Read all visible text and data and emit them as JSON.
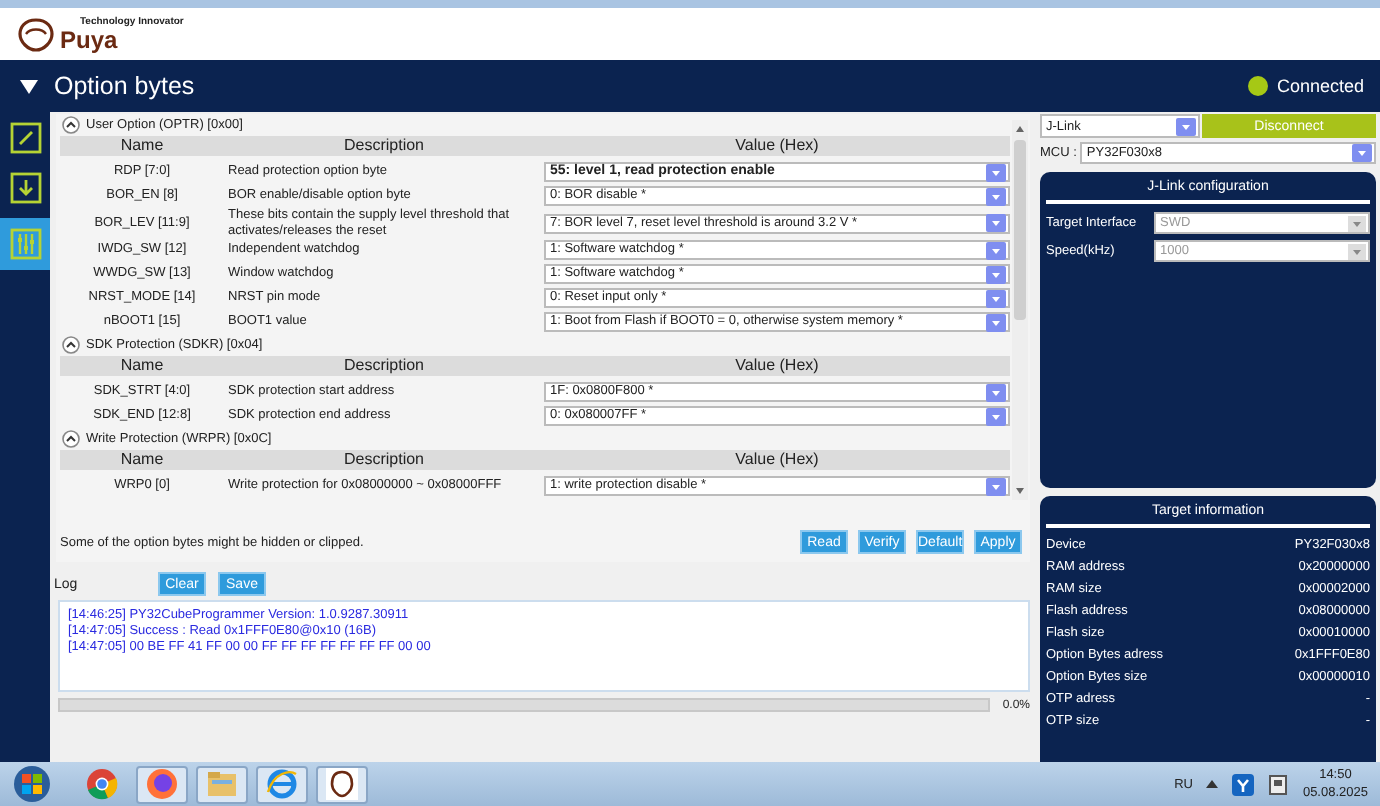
{
  "app": {
    "logo_text": "Puya",
    "tagline": "Technology Innovator"
  },
  "header": {
    "title": "Option bytes",
    "status": "Connected",
    "connected": true
  },
  "nav": [
    {
      "kind": "edit",
      "selected": false
    },
    {
      "kind": "download",
      "selected": false
    },
    {
      "kind": "sliders",
      "selected": true
    }
  ],
  "sections": [
    {
      "title": "User Option (OPTR) [0x00]",
      "expanded": true,
      "columns": [
        "Name",
        "Description",
        "Value (Hex)"
      ],
      "rows": [
        {
          "name": "RDP [7:0]",
          "description": "Read protection option byte",
          "value": "55: level 1, read protection enable",
          "emphasized": true
        },
        {
          "name": "BOR_EN [8]",
          "description": "BOR enable/disable option byte",
          "value": "0: BOR disable *",
          "emphasized": false
        },
        {
          "name": "BOR_LEV [11:9]",
          "description": "These bits contain the supply level threshold that activates/releases the reset",
          "value": "7: BOR level 7, reset level threshold is around 3.2 V *",
          "emphasized": false
        },
        {
          "name": "IWDG_SW [12]",
          "description": "Independent watchdog",
          "value": "1: Software watchdog *",
          "emphasized": false
        },
        {
          "name": "WWDG_SW [13]",
          "description": "Window watchdog",
          "value": "1: Software watchdog *",
          "emphasized": false
        },
        {
          "name": "NRST_MODE [14]",
          "description": "NRST pin mode",
          "value": "0: Reset input only *",
          "emphasized": false
        },
        {
          "name": "nBOOT1 [15]",
          "description": "BOOT1 value",
          "value": "1: Boot from Flash if BOOT0 = 0, otherwise system memory *",
          "emphasized": false
        }
      ]
    },
    {
      "title": "SDK Protection (SDKR) [0x04]",
      "expanded": true,
      "columns": [
        "Name",
        "Description",
        "Value (Hex)"
      ],
      "rows": [
        {
          "name": "SDK_STRT [4:0]",
          "description": "SDK protection start address",
          "value": "1F: 0x0800F800 *",
          "emphasized": false
        },
        {
          "name": "SDK_END [12:8]",
          "description": "SDK protection end address",
          "value": "0: 0x080007FF *",
          "emphasized": false
        }
      ]
    },
    {
      "title": "Write Protection (WRPR) [0x0C]",
      "expanded": true,
      "columns": [
        "Name",
        "Description",
        "Value (Hex)"
      ],
      "rows": [
        {
          "name": "WRP0 [0]",
          "description": "Write protection for 0x08000000 ~ 0x08000FFF",
          "value": "1: write protection disable *",
          "emphasized": false
        }
      ]
    }
  ],
  "note": "Some of the option bytes might be hidden or clipped.",
  "actions": [
    "Read",
    "Verify",
    "Default",
    "Apply"
  ],
  "log": {
    "label": "Log",
    "buttons": [
      "Clear",
      "Save"
    ],
    "lines": [
      "[14:46:25] PY32CubeProgrammer Version: 1.0.9287.30911",
      "[14:47:05] Success : Read 0x1FFF0E80@0x10 (16B)",
      "[14:47:05] 00 BE FF 41 FF 00 00 FF FF FF FF FF FF FF 00 00"
    ],
    "progress": {
      "level": 0,
      "reading": "0.0%"
    }
  },
  "probe": {
    "value": "J-Link",
    "button": "Disconnect",
    "mcu_label": "MCU :",
    "mcu": "PY32F030x8"
  },
  "config": {
    "title": "J-Link configuration",
    "fields": [
      {
        "label": "Target Interface",
        "value": "SWD",
        "disabled": true
      },
      {
        "label": "Speed(kHz)",
        "value": "1000",
        "disabled": true
      }
    ]
  },
  "target_info": {
    "title": "Target information",
    "rows": [
      {
        "label": "Device",
        "value": "PY32F030x8"
      },
      {
        "label": "RAM address",
        "value": "0x20000000"
      },
      {
        "label": "RAM size",
        "value": "0x00002000"
      },
      {
        "label": "Flash address",
        "value": "0x08000000"
      },
      {
        "label": "Flash size",
        "value": "0x00010000"
      },
      {
        "label": "Option Bytes adress",
        "value": "0x1FFF0E80"
      },
      {
        "label": "Option Bytes size",
        "value": "0x00000010"
      },
      {
        "label": "OTP adress",
        "value": "-"
      },
      {
        "label": "OTP size",
        "value": "-"
      }
    ]
  },
  "taskbar": {
    "apps": [
      {
        "kind": "chrome",
        "active": false
      },
      {
        "kind": "firefox",
        "active": true
      },
      {
        "kind": "folder",
        "active": true
      },
      {
        "kind": "browser",
        "active": true
      },
      {
        "kind": "programmer",
        "active": true
      }
    ],
    "language": "RU",
    "time": "14:50",
    "date": "05.08.2025"
  }
}
